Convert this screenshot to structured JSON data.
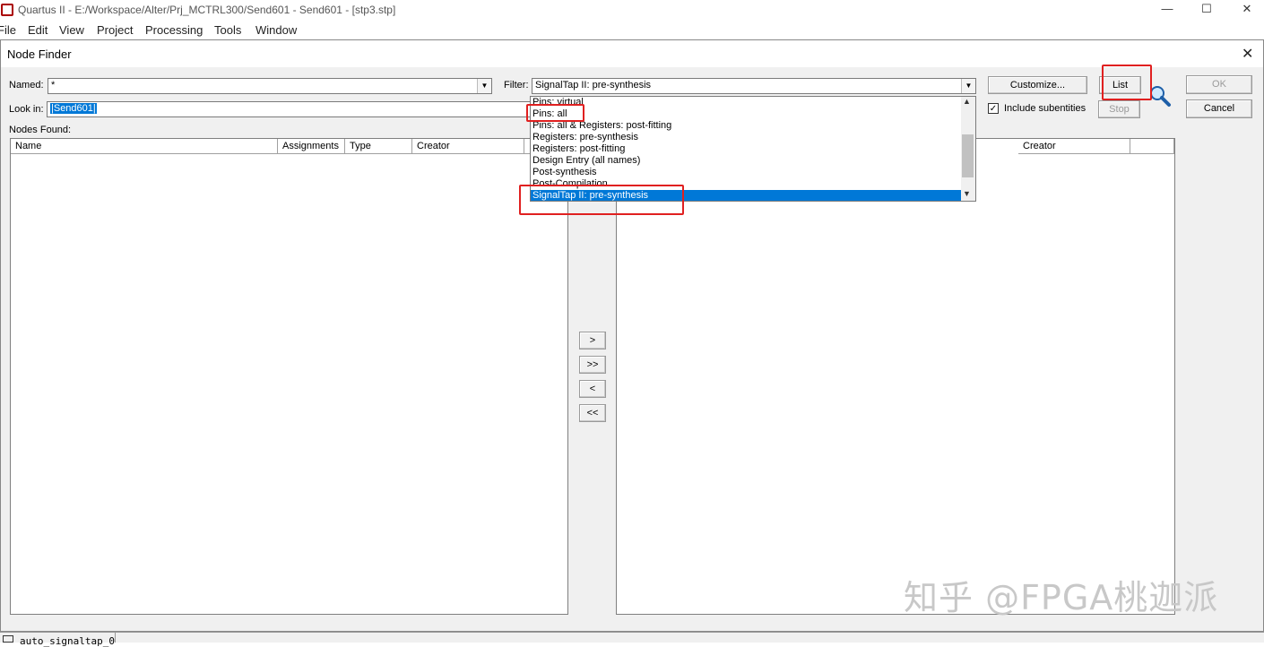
{
  "app": {
    "title": "Quartus II - E:/Workspace/Alter/Prj_MCTRL300/Send601 - Send601 - [stp3.stp]",
    "minimize_glyph": "—",
    "maximize_glyph": "☐",
    "close_glyph": "✕"
  },
  "menu": [
    "File",
    "Edit",
    "View",
    "Project",
    "Processing",
    "Tools",
    "Window"
  ],
  "dialog": {
    "title": "Node Finder",
    "close_glyph": "✕",
    "named_label": "Named:",
    "named_value": "*",
    "filter_label": "Filter:",
    "filter_value": "SignalTap II: pre-synthesis",
    "lookin_label": "Look in:",
    "lookin_value": "|Send601|",
    "nodes_found_label": "Nodes Found:",
    "include_subentities_label": "Include subentities",
    "include_subentities_checked": true,
    "buttons": {
      "customize": "Customize...",
      "list": "List",
      "stop": "Stop",
      "ok": "OK",
      "cancel": "Cancel"
    },
    "left_columns": [
      "Name",
      "Assignments",
      "Type",
      "Creator"
    ],
    "right_columns": [
      "Creator"
    ],
    "move_buttons": [
      ">",
      ">>",
      "<",
      "<<"
    ],
    "filter_options": [
      "Pins: virtual",
      "Pins: all",
      "Pins: all & Registers: post-fitting",
      "Registers: pre-synthesis",
      "Registers: post-fitting",
      "Design Entry (all names)",
      "Post-synthesis",
      "Post-Compilation",
      "SignalTap II: pre-synthesis"
    ],
    "selected_filter": "SignalTap II: pre-synthesis"
  },
  "highlight_color": "#e02020",
  "selection_color": "#0078d7",
  "watermark": "知乎 @FPGA桃迦派",
  "taskbar_text": "auto_signaltap_0"
}
